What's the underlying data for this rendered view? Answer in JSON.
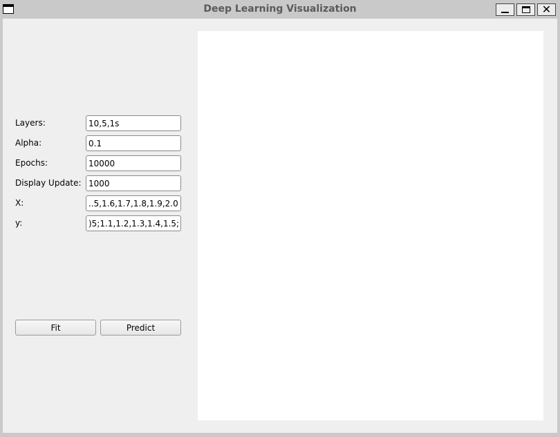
{
  "window": {
    "title": "Deep Learning Visualization",
    "controls": {
      "minimize_icon": "minimize-icon",
      "maximize_icon": "maximize-icon",
      "close_icon": "close-icon"
    }
  },
  "form": {
    "fields": [
      {
        "label": "Layers:",
        "value": "10,5,1s"
      },
      {
        "label": "Alpha:",
        "value": "0.1"
      },
      {
        "label": "Epochs:",
        "value": "10000"
      },
      {
        "label": "Display Update:",
        "value": "1000"
      },
      {
        "label": "X:",
        "value": "..5,1.6,1.7,1.8,1.9,2.0;"
      },
      {
        "label": "y:",
        "value": ")5;1.1,1.2,1.3,1.4,1.5;"
      }
    ]
  },
  "buttons": {
    "fit_label": "Fit",
    "predict_label": "Predict"
  },
  "colors": {
    "window_frame": "#c9c9c9",
    "panel": "#efefef",
    "plot_background": "#ffffff",
    "title_text": "#5a5a5a"
  }
}
